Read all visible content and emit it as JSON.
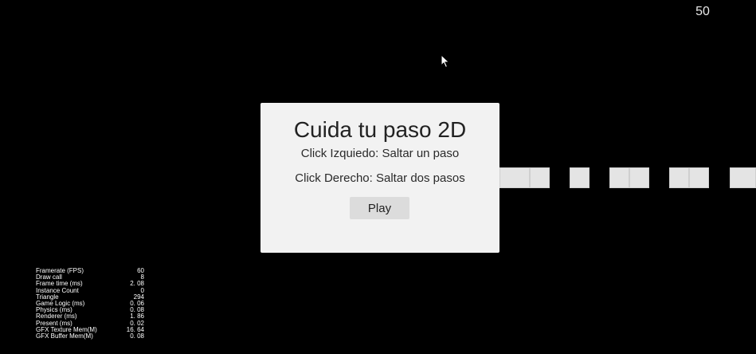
{
  "hud": {
    "score": "50"
  },
  "menu": {
    "title": "Cuida tu paso 2D",
    "line_left_click": "Click Izquiedo: Saltar un paso",
    "line_right_click": "Click Derecho: Saltar dos pasos",
    "play_label": "Play"
  },
  "stats": [
    {
      "label": "Framerate (FPS)",
      "value": "60"
    },
    {
      "label": "Draw call",
      "value": "8"
    },
    {
      "label": "Frame time (ms)",
      "value": "2. 08"
    },
    {
      "label": "Instance Count",
      "value": "0"
    },
    {
      "label": "Triangle",
      "value": "294"
    },
    {
      "label": "Game Logic (ms)",
      "value": "0. 06"
    },
    {
      "label": "Physics (ms)",
      "value": "0. 08"
    },
    {
      "label": "Renderer (ms)",
      "value": "1. 86"
    },
    {
      "label": "Present (ms)",
      "value": "0. 02"
    },
    {
      "label": "GFX Texture Mem(M)",
      "value": "16. 64"
    },
    {
      "label": "GFX Buffer Mem(M)",
      "value": "0. 08"
    }
  ],
  "colors": {
    "background": "#000000",
    "tile": "#e4e4e4",
    "panel": "#f2f2f2"
  }
}
